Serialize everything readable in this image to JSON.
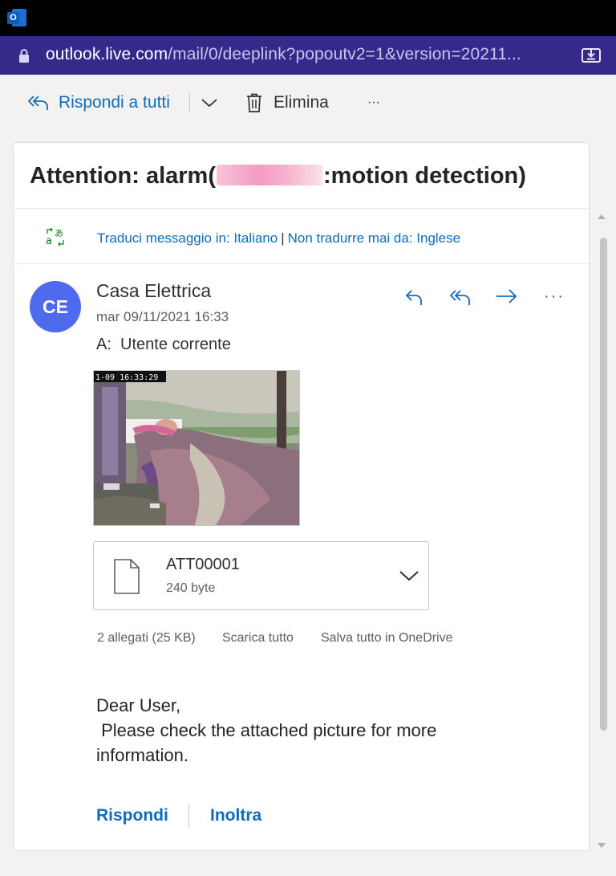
{
  "browser": {
    "url_host": "outlook.live.com",
    "url_path": "/mail/0/deeplink?popoutv2=1&version=20211..."
  },
  "toolbar": {
    "reply_all_label": "Rispondi a tutti",
    "delete_label": "Elimina",
    "more_label": "···"
  },
  "message": {
    "subject_start": "Attention: alarm(",
    "subject_end": ":motion detection)",
    "translate": {
      "translate_link": "Traduci messaggio in: Italiano",
      "separator": "|",
      "never_translate_link": "Non tradurre mai da: Inglese"
    },
    "sender_initials": "CE",
    "sender_name": "Casa Elettrica",
    "date": "mar 09/11/2021 16:33",
    "recipient": "A:  Utente corrente",
    "more_actions": "···",
    "image_timestamp": "1-09   16:33:29",
    "attachment": {
      "name": "ATT00001",
      "size": "240 byte"
    },
    "attachments_count": "2 allegati (25 KB)",
    "download_all": "Scarica tutto",
    "save_onedrive": "Salva tutto in OneDrive",
    "body": "Dear User,\n Please check the attached picture for more information.",
    "reply_link": "Rispondi",
    "forward_link": "Inoltra"
  },
  "colors": {
    "accent": "#0f6cbd",
    "address_bar": "#352a8a",
    "avatar": "#4f6bed"
  },
  "icons": [
    "outlook-app-icon",
    "lock-icon",
    "install-app-icon",
    "reply-all-icon",
    "chevron-down-icon",
    "trash-icon",
    "translate-icon",
    "reply-icon",
    "forward-icon",
    "file-icon"
  ]
}
